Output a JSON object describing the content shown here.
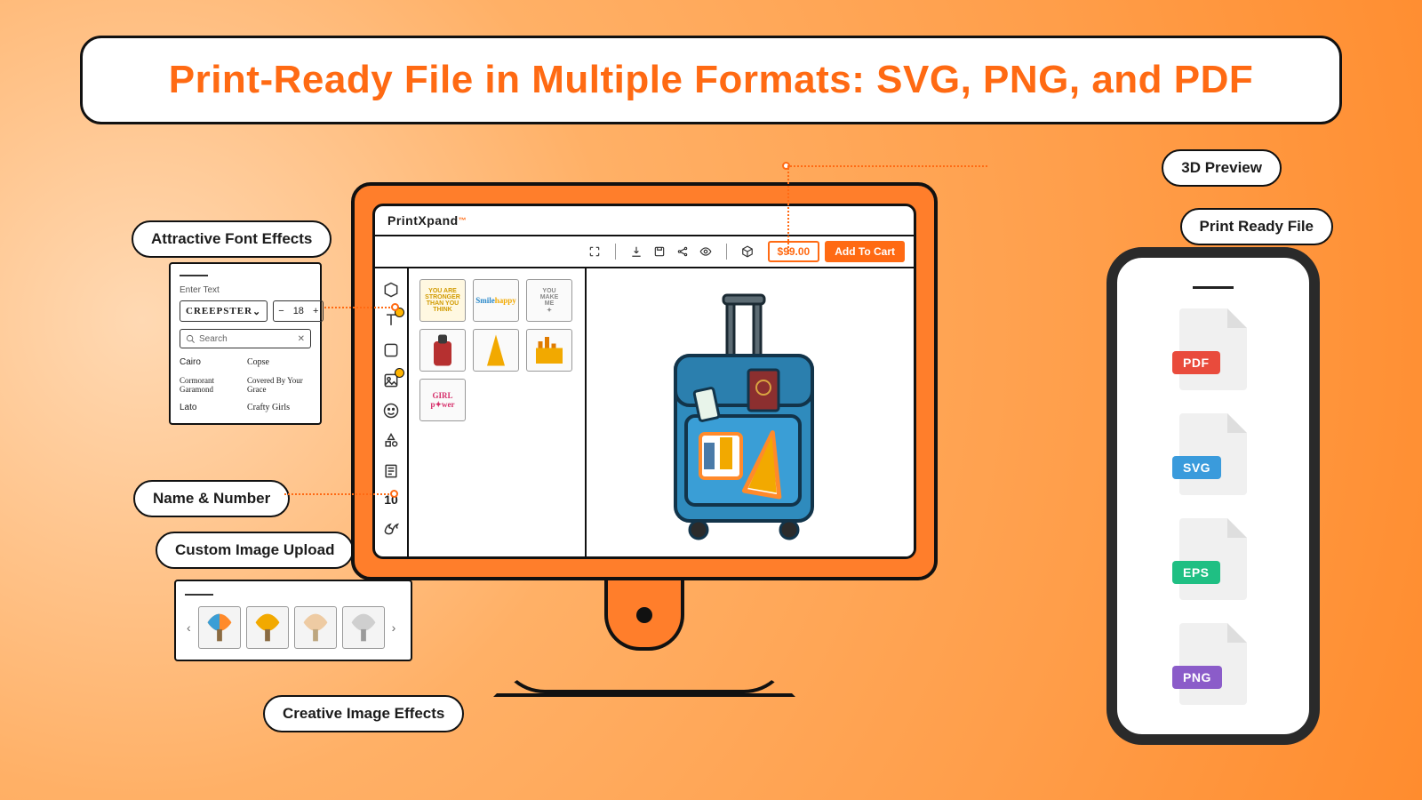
{
  "headline": "Print-Ready File in Multiple Formats: SVG, PNG, and PDF",
  "brand": {
    "name": "PrintXpand",
    "mark": "™"
  },
  "toolbar": {
    "price": "$99.00",
    "cta": "Add To Cart"
  },
  "callouts": {
    "threeD": "3D Preview",
    "print": "Print Ready File",
    "font": "Attractive Font Effects",
    "nn": "Name & Number",
    "upload": "Custom Image Upload",
    "fx": "Creative Image Effects"
  },
  "font_panel": {
    "label": "Enter Text",
    "family": "CREEPSTER",
    "size": "18",
    "search_placeholder": "Search",
    "families": [
      "Cairo",
      "Copse",
      "Cormorant Garamond",
      "Covered By Your Grace",
      "Lato",
      "Crafty Girls"
    ]
  },
  "rail_number": "10",
  "file_formats": [
    {
      "label": "PDF",
      "color": "#e94b3c"
    },
    {
      "label": "SVG",
      "color": "#3a9bdc"
    },
    {
      "label": "EPS",
      "color": "#1fbf83"
    },
    {
      "label": "PNG",
      "color": "#8b5cc9"
    }
  ]
}
